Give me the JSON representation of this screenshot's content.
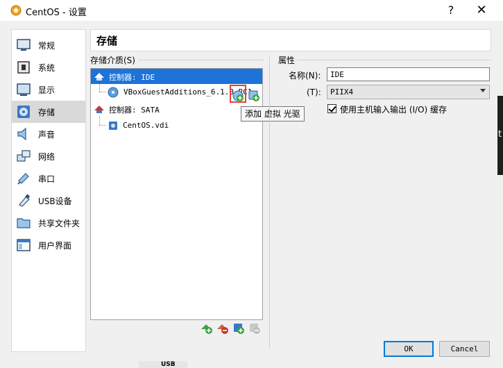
{
  "window": {
    "title": "CentOS - 设置",
    "help_label": "?",
    "close_label": "✕"
  },
  "sidebar": {
    "items": [
      {
        "label": "常规",
        "icon": "general-icon"
      },
      {
        "label": "系统",
        "icon": "system-icon"
      },
      {
        "label": "显示",
        "icon": "display-icon"
      },
      {
        "label": "存储",
        "icon": "storage-icon",
        "selected": true
      },
      {
        "label": "声音",
        "icon": "audio-icon"
      },
      {
        "label": "网络",
        "icon": "network-icon"
      },
      {
        "label": "串口",
        "icon": "serial-port-icon"
      },
      {
        "label": "USB设备",
        "icon": "usb-icon"
      },
      {
        "label": "共享文件夹",
        "icon": "shared-folder-icon"
      },
      {
        "label": "用户界面",
        "icon": "user-interface-icon"
      }
    ]
  },
  "page": {
    "title": "存储"
  },
  "storage": {
    "tree_label": "存储介质(S)",
    "tree": [
      {
        "label": "控制器: IDE",
        "type": "controller",
        "selected": true
      },
      {
        "label": "VBoxGuestAdditions_6.1.0_RC1",
        "type": "optical"
      },
      {
        "label": "控制器: SATA",
        "type": "controller"
      },
      {
        "label": "CentOS.vdi",
        "type": "disk"
      }
    ],
    "tooltip": "添加 虚拟 光驱"
  },
  "attributes": {
    "section_label": "属性",
    "name_label": "名称(N):",
    "name_value": "IDE",
    "type_label": "(T):",
    "type_value": "PIIX4",
    "use_host_io_label": "使用主机输入输出 (I/O) 缓存",
    "use_host_io_checked": true
  },
  "buttons": {
    "ok": "OK",
    "cancel": "Cancel"
  },
  "background": {
    "edge_text": "t",
    "strip_text": "USB"
  },
  "colors": {
    "selection": "#1e73d9",
    "highlight_border": "#e0403a",
    "ok_border": "#0078d7"
  }
}
